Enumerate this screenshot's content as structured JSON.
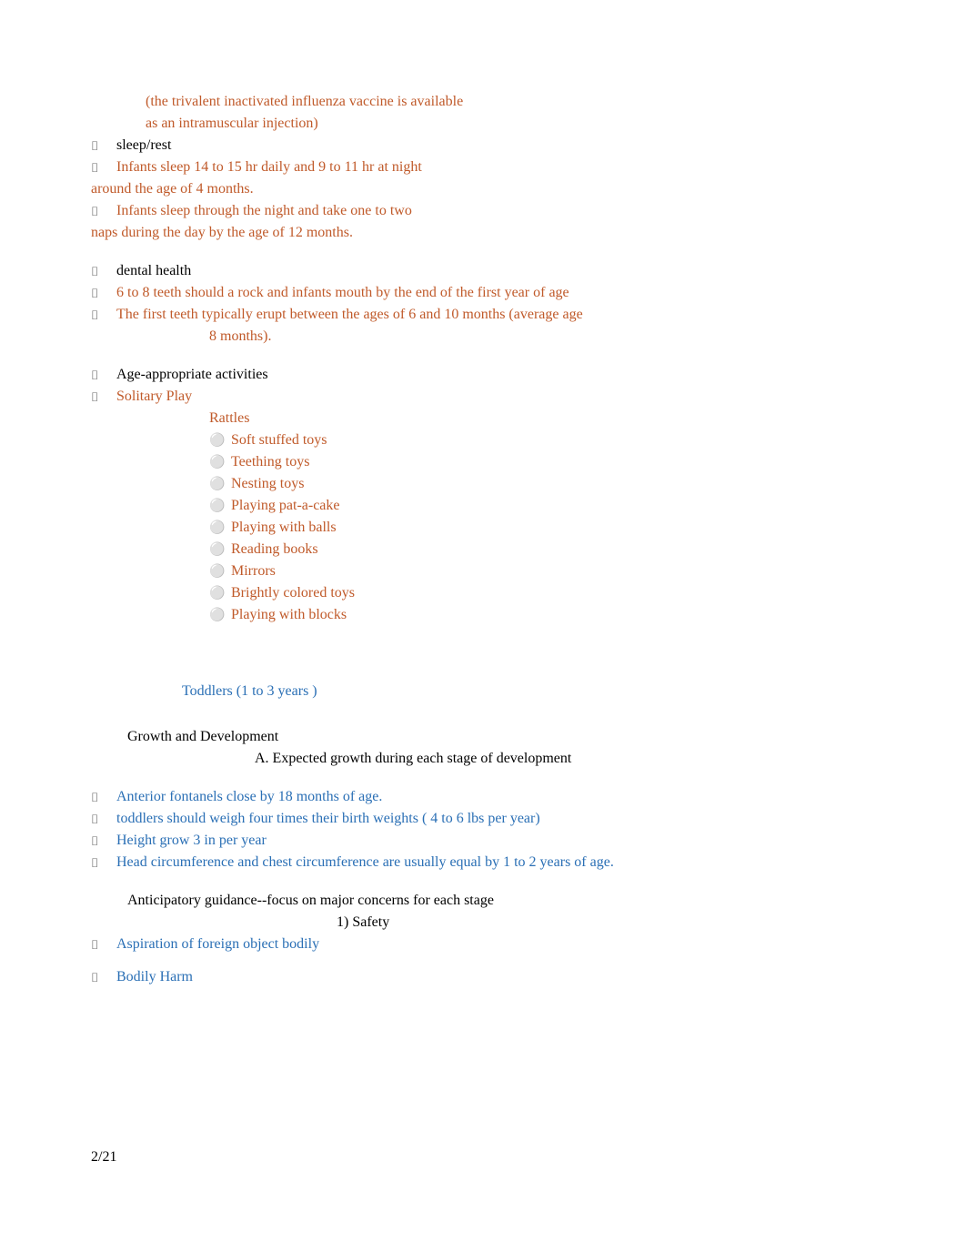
{
  "top": {
    "line1": "(the trivalent inactivated influenza vaccine is available",
    "line2": "as an intramuscular injection)"
  },
  "sleep_heading": "sleep/rest",
  "sleep_b1a": "Infants sleep 14 to 15 hr daily and 9 to 11 hr at night",
  "sleep_b1b": "around the age of 4 months.",
  "sleep_b2a": "Infants sleep through the night and take one to two",
  "sleep_b2b": "naps during the day by the age of 12 months.",
  "dental_heading": "dental health",
  "dental_b1": "6 to 8 teeth should a rock and infants mouth by the end of the first year of age",
  "dental_b2a": "The first teeth typically erupt between the ages of 6 and 10 months (average age",
  "dental_b2b": "8 months).",
  "activities_heading": "Age-appropriate activities",
  "solitary": "Solitary Play",
  "rattles": "Rattles",
  "toys": [
    "Soft stuffed toys",
    "Teething toys",
    "Nesting toys",
    "Playing pat-a-cake",
    "Playing with balls",
    "Reading books",
    "Mirrors",
    "Brightly colored toys",
    "Playing with blocks"
  ],
  "toddlers_heading": "Toddlers (1 to 3 years )",
  "growth_heading": "Growth and Development",
  "growth_sub": "A.   Expected growth during each stage of development",
  "growth_items": [
    "Anterior fontanels close by 18 months of age.",
    "toddlers should weigh four times their birth weights ( 4 to 6 lbs per year)",
    "Height grow 3 in per year",
    "Head circumference and chest circumference are usually equal by 1 to 2 years of age."
  ],
  "anticipatory": "Anticipatory guidance--focus on major concerns for each stage",
  "safety_num": "1)   Safety",
  "asp": "Aspiration of foreign object bodily",
  "bodily": "Bodily Harm",
  "footer": "2/21"
}
